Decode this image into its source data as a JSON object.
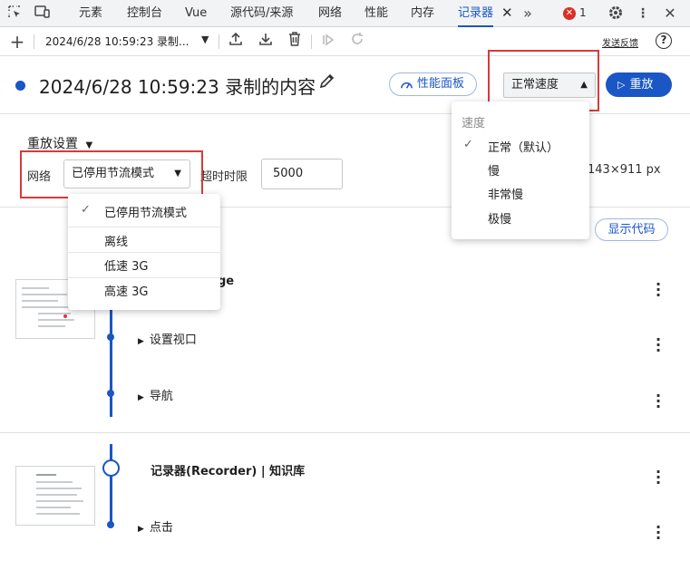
{
  "tabs": [
    {
      "label": "元素"
    },
    {
      "label": "控制台"
    },
    {
      "label": "Vue"
    },
    {
      "label": "源代码/来源"
    },
    {
      "label": "网络"
    },
    {
      "label": "性能"
    },
    {
      "label": "内存"
    },
    {
      "label": "记录器"
    }
  ],
  "tab_close": "✕",
  "more_tabs": "»",
  "error_badge": {
    "count": "1",
    "color": "#d93025"
  },
  "toolbar": {
    "recording_select": "2024/6/28 10:59:23 录制...",
    "feedback_link": "发送反馈",
    "help": "?"
  },
  "header": {
    "title": "2024/6/28 10:59:23 录制的内容",
    "perf_panel_button": "性能面板",
    "speed_select": "正常速度",
    "replay_button": "重放"
  },
  "settings": {
    "title": "重放设置",
    "network_label": "网络",
    "network_value": "已停用节流模式",
    "timeout_label": "超时时限",
    "timeout_value": "5000",
    "viewport_size": "143×911 px"
  },
  "show_code_button": "显示代码",
  "steps": {
    "group1_title_partial": "ge",
    "set_viewport": "设置视口",
    "navigate": "导航",
    "group2_title": "记录器(Recorder) | 知识库",
    "click": "点击"
  },
  "speed_menu": {
    "header": "速度",
    "items": [
      "正常（默认）",
      "慢",
      "非常慢",
      "极慢"
    ],
    "selected_index": 0
  },
  "network_menu": {
    "items": [
      "已停用节流模式",
      "离线",
      "低速 3G",
      "高速 3G"
    ],
    "selected_index": 0
  },
  "colors": {
    "accent": "#1a56c4",
    "highlight": "#d93a3a"
  }
}
